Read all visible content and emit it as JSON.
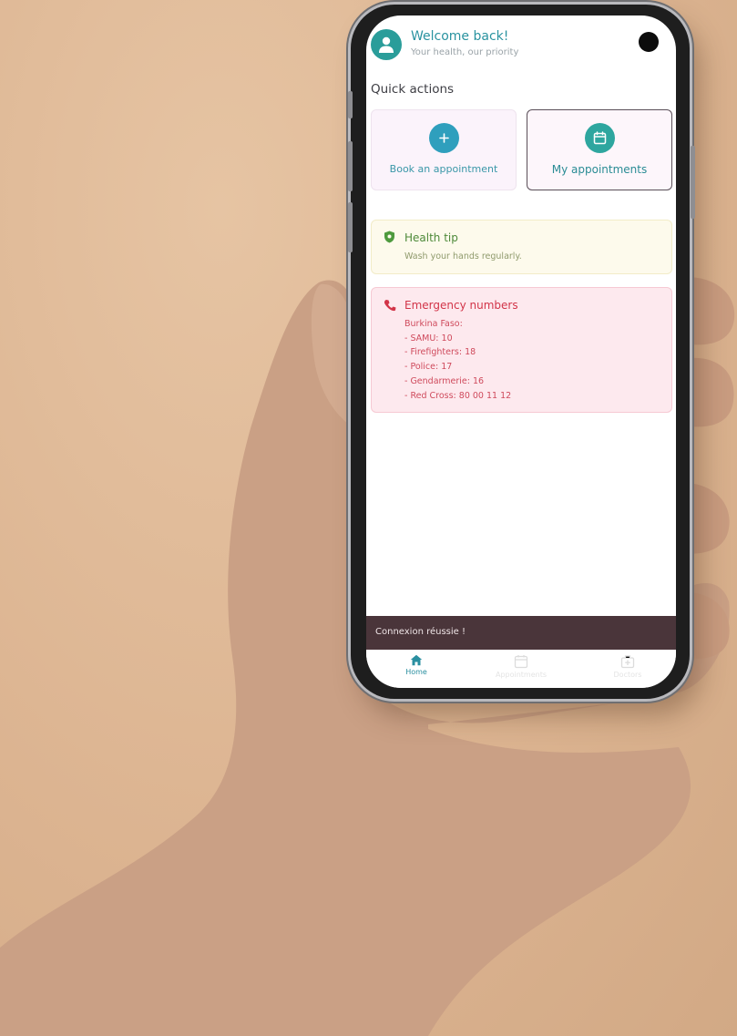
{
  "header": {
    "welcome": "Welcome back!",
    "subtitle": "Your health, our priority",
    "avatar_icon": "person-icon"
  },
  "quick_actions": {
    "title": "Quick actions",
    "items": [
      {
        "label": "Book an appointment",
        "icon": "plus-icon",
        "color": "#2f9fbd"
      },
      {
        "label": "My appointments",
        "icon": "calendar-icon",
        "color": "#2ea69f"
      }
    ]
  },
  "health_tip": {
    "title": "Health tip",
    "text": "Wash your hands regularly.",
    "icon": "shield-icon"
  },
  "emergency": {
    "title": "Emergency numbers",
    "icon": "phone-icon",
    "lines": [
      "Burkina Faso:",
      "- SAMU: 10",
      "- Firefighters: 18",
      "- Police: 17",
      "- Gendarmerie: 16",
      "- Red Cross: 80 00 11 12"
    ]
  },
  "toast": {
    "message": "Connexion réussie !"
  },
  "bottom_nav": {
    "items": [
      {
        "label": "Home",
        "icon": "home-icon",
        "active": true
      },
      {
        "label": "Appointments",
        "icon": "calendar-icon",
        "active": false
      },
      {
        "label": "Doctors",
        "icon": "medical-bag-icon",
        "active": false
      }
    ]
  },
  "colors": {
    "accent": "#2a93a0",
    "emergency": "#d23448",
    "tip": "#4e8a3a",
    "toast_bg": "#4a353a"
  }
}
